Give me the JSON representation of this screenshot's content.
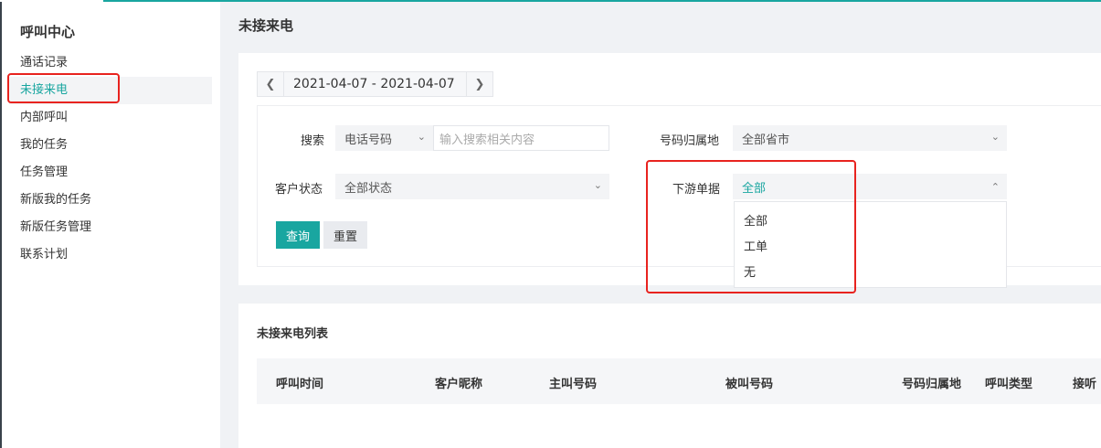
{
  "sidebar": {
    "title": "呼叫中心",
    "items": [
      {
        "label": "通话记录"
      },
      {
        "label": "未接来电"
      },
      {
        "label": "内部呼叫"
      },
      {
        "label": "我的任务"
      },
      {
        "label": "任务管理"
      },
      {
        "label": "新版我的任务"
      },
      {
        "label": "新版任务管理"
      },
      {
        "label": "联系计划"
      }
    ]
  },
  "page": {
    "title": "未接来电"
  },
  "date_range": {
    "value": "2021-04-07 - 2021-04-07",
    "prev_icon": "chevron-left-icon",
    "next_icon": "chevron-right-icon"
  },
  "filters": {
    "search_label": "搜索",
    "search_type": "电话号码",
    "search_placeholder": "输入搜索相关内容",
    "region_label": "号码归属地",
    "region_value": "全部省市",
    "status_label": "客户状态",
    "status_value": "全部状态",
    "downstream_label": "下游单据",
    "downstream_value": "全部",
    "downstream_options": [
      "全部",
      "工单",
      "无"
    ],
    "query_button": "查询",
    "reset_button": "重置"
  },
  "list": {
    "title": "未接来电列表",
    "columns": [
      "呼叫时间",
      "客户昵称",
      "主叫号码",
      "被叫号码",
      "号码归属地",
      "呼叫类型",
      "接听"
    ]
  },
  "colors": {
    "accent": "#19a6a0",
    "highlight": "#e8231f"
  }
}
